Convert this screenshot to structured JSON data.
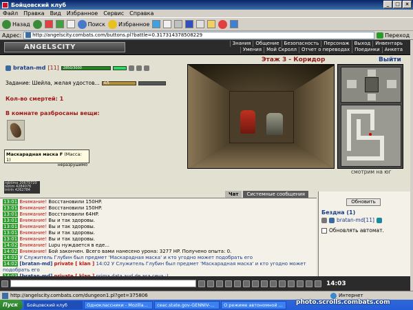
{
  "window": {
    "title": "Бойцовский клуб"
  },
  "menu": [
    "Файл",
    "Правка",
    "Вид",
    "Избранное",
    "Сервис",
    "Справка"
  ],
  "toolbar": {
    "back": "Назад",
    "search": "Поиск",
    "favorites": "Избранное"
  },
  "address": {
    "label": "Адрес:",
    "url": "http://angelscity.combats.com/buttons.pl?battle=0.317314378508229",
    "go": "Переход"
  },
  "game": {
    "logo": "ANGELSCITY",
    "nav": [
      "Знания",
      "Общение",
      "Безопасность",
      "Персонаж",
      "Выход",
      "Инвентарь",
      "Умения",
      "Мой Скролл",
      "Отчет о переводах",
      "Поединки",
      "Анкета"
    ],
    "player": {
      "nick": "bratan-md",
      "level": "[11]",
      "hp": "2850/3000"
    },
    "quest": {
      "text": "Задание: Шейла, желая удостов...",
      "progress": "4/5"
    },
    "deaths": "Кол-во смертей: 1",
    "room_items_title": "В комнате разбросаны вещи:",
    "item": {
      "name": "Маскарадная маска F",
      "mass": "(Масса: 1)",
      "note": "неразрушимо"
    },
    "counter": "rgbtime 20679720\nnotim 4284076\nintrln 4262784",
    "floor": "Этаж 3 - Коридор",
    "exit": "Выйти",
    "look": "смотрим на юг"
  },
  "chat": {
    "tabs": [
      "Чат",
      "Системные сообщения"
    ],
    "lines": [
      {
        "time": "13:01",
        "type": "warn",
        "text": "Восстановили 150HP."
      },
      {
        "time": "13:01",
        "type": "warn",
        "text": "Восстановили 150HP."
      },
      {
        "time": "13:01",
        "type": "warn",
        "text": "Восстановили 64HP."
      },
      {
        "time": "13:01",
        "type": "warn",
        "text": "Вы и так здоровы."
      },
      {
        "time": "13:01",
        "type": "warn",
        "text": "Вы и так здоровы."
      },
      {
        "time": "13:01",
        "type": "warn",
        "text": "Вы и так здоровы."
      },
      {
        "time": "13:01",
        "type": "warn",
        "text": "Вы и так здоровы."
      },
      {
        "time": "14:02",
        "type": "warn",
        "text": "Lupu нуждается в еде..."
      },
      {
        "time": "14:02",
        "type": "battle",
        "text": "Бой закончен. Всего вами нанесено урона: 3277 HP. Получено опыта: 0."
      },
      {
        "time": "14:02",
        "type": "sys",
        "text": "У Служитель Глубин был предмет 'Маскарадная маска' и кто угодно может подобрать его"
      },
      {
        "time": "14:02",
        "type": "priv",
        "nick": "[bratan-md]",
        "tag": "private [ klan ]",
        "text": "14:02 У Служитель Глубин был предмет 'Маскарадная маска' и кто угодно может подобрать его"
      },
      {
        "time": "14:03",
        "type": "priv",
        "nick": "[bratan-md]",
        "tag": "private [ klan ]",
        "text": "prima data aud de asa ceva :)"
      }
    ],
    "warn_label": "Внимание!"
  },
  "room": {
    "refresh": "Обновить",
    "name": "Бездна (1)",
    "player": "bratan-md[11]",
    "auto": "Обновлять автомат."
  },
  "bottom": {
    "clock": "14:03"
  },
  "status": {
    "url": "http://angelscity.combats.com/dungeon1.pl?get=375806",
    "zone": "Интернет"
  },
  "taskbar": {
    "start": "Пуск",
    "tasks": [
      "Бойцовский клуб",
      "Одноклассники - Mozilla...",
      "ceac.state.gov-GENNIV-...",
      "О режиме автономной ..."
    ]
  },
  "watermark": "photo.scrolls.combats.com",
  "colors": {
    "titlebar": "#0a246a",
    "game_header": "#2b2b2b",
    "warn": "#c01010",
    "nick": "#1a3a8a"
  }
}
